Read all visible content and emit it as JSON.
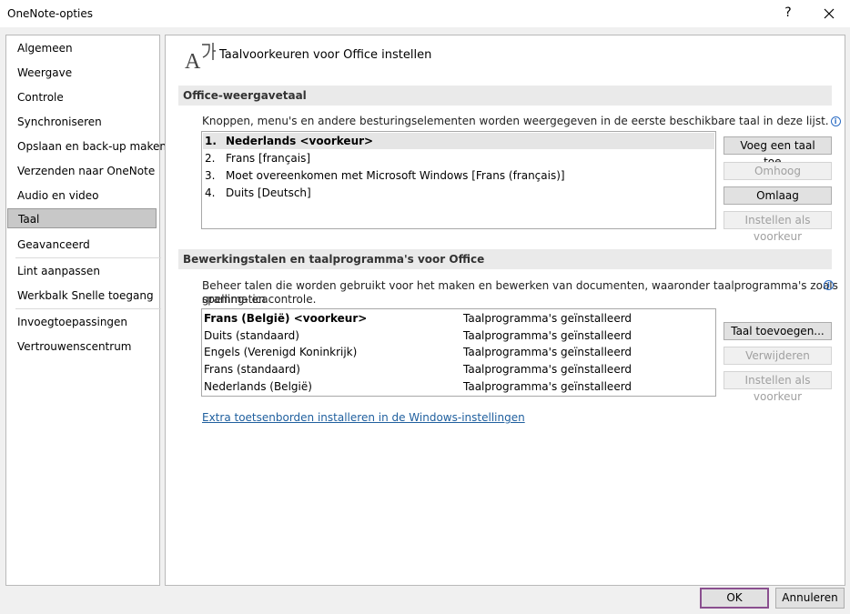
{
  "window": {
    "title": "OneNote-opties",
    "help_label": "?"
  },
  "sidebar": {
    "items": [
      {
        "label": "Algemeen"
      },
      {
        "label": "Weergave"
      },
      {
        "label": "Controle"
      },
      {
        "label": "Synchroniseren"
      },
      {
        "label": "Opslaan en back-up maken"
      },
      {
        "label": "Verzenden naar OneNote"
      },
      {
        "label": "Audio en video"
      },
      {
        "label": "Taal",
        "selected": true
      },
      {
        "label": "Geavanceerd"
      },
      {
        "label": "Lint aanpassen"
      },
      {
        "label": "Werkbalk Snelle toegang"
      },
      {
        "label": "Invoegtoepassingen"
      },
      {
        "label": "Vertrouwenscentrum"
      }
    ]
  },
  "header": {
    "title": "Taalvoorkeuren voor Office instellen",
    "icon": "language-icon"
  },
  "display_language": {
    "section_title": "Office-weergavetaal",
    "description": "Knoppen, menu's en andere besturingselementen worden weergegeven in de eerste beschikbare taal in deze lijst.",
    "items": [
      {
        "num": "1.",
        "name": "Nederlands <voorkeur>",
        "selected": true
      },
      {
        "num": "2.",
        "name": "Frans [français]"
      },
      {
        "num": "3.",
        "name": "Moet overeenkomen met Microsoft Windows [Frans (français)]"
      },
      {
        "num": "4.",
        "name": "Duits [Deutsch]"
      }
    ],
    "buttons": {
      "add": "Voeg een taal toe...",
      "up": "Omhoog",
      "down": "Omlaag",
      "set_preferred": "Instellen als voorkeur"
    }
  },
  "editing_languages": {
    "section_title": "Bewerkingstalen en taalprogramma's voor Office",
    "description_line1": "Beheer talen die worden gebruikt voor het maken en bewerken van documenten, waaronder taalprogramma's zoals spelling- en",
    "description_line2": "grammaticacontrole.",
    "items": [
      {
        "name": "Frans (België) <voorkeur>",
        "status": "Taalprogramma's geïnstalleerd",
        "bold": true
      },
      {
        "name": "Duits (standaard)",
        "status": "Taalprogramma's geïnstalleerd"
      },
      {
        "name": "Engels (Verenigd Koninkrijk)",
        "status": "Taalprogramma's geïnstalleerd"
      },
      {
        "name": "Frans (standaard)",
        "status": "Taalprogramma's geïnstalleerd"
      },
      {
        "name": "Nederlands (België)",
        "status": "Taalprogramma's geïnstalleerd"
      }
    ],
    "buttons": {
      "add": "Taal toevoegen...",
      "remove": "Verwijderen",
      "set_preferred": "Instellen als voorkeur"
    }
  },
  "keyboard_link": "Extra toetsenborden installeren in de Windows-instellingen",
  "footer": {
    "ok": "OK",
    "cancel": "Annuleren"
  },
  "colors": {
    "accent": "#8a4f8f",
    "link": "#1f5f9e",
    "info": "#2b6cc4"
  }
}
